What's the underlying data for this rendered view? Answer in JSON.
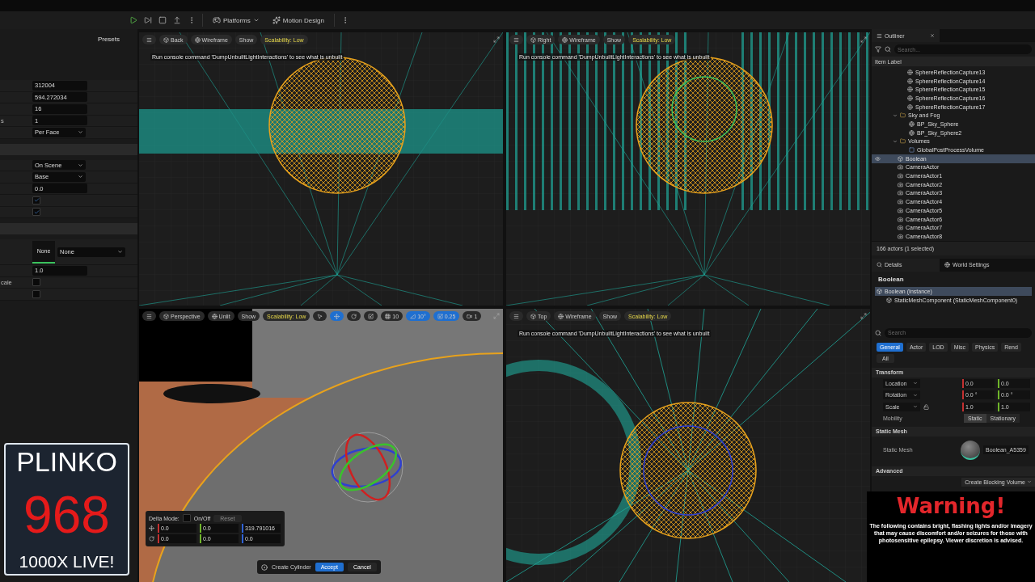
{
  "toolbar": {
    "items": [
      {
        "label": "Platforms"
      },
      {
        "label": "Motion Design"
      }
    ]
  },
  "left_panel": {
    "presets": "Presets",
    "rows": [
      {
        "kind": "field",
        "value": "312004"
      },
      {
        "kind": "field",
        "value": "594.272034"
      },
      {
        "kind": "field",
        "value": "16"
      },
      {
        "kind": "field",
        "label": "s",
        "value": "1"
      },
      {
        "kind": "dropdown",
        "value": "Per Face"
      },
      {
        "kind": "section"
      },
      {
        "kind": "dropdown",
        "value": "On Scene"
      },
      {
        "kind": "dropdown",
        "value": "Base"
      },
      {
        "kind": "field",
        "value": "0.0"
      },
      {
        "kind": "checkbox",
        "checked": true
      },
      {
        "kind": "checkbox",
        "checked": true
      },
      {
        "kind": "section"
      },
      {
        "kind": "asset",
        "thumb": "None",
        "value": "None"
      },
      {
        "kind": "field",
        "value": "1.0"
      },
      {
        "kind": "checkbox",
        "label": "cale",
        "checked": false
      },
      {
        "kind": "checkbox",
        "checked": false
      }
    ]
  },
  "viewports": [
    {
      "kind": "ortho",
      "view": "Back",
      "mode": "Wireframe",
      "show": "Show",
      "scalability": "Scalability: Low",
      "message": "Run console command 'DumpUnbuiltLightInteractions' to see what is unbuilt"
    },
    {
      "kind": "ortho",
      "view": "Right",
      "mode": "Wireframe",
      "show": "Show",
      "scalability": "Scalability: Low",
      "message": "Run console command 'DumpUnbuiltLightInteractions' to see what is unbuilt"
    },
    {
      "kind": "perspective",
      "view": "Perspective",
      "mode": "Unlit",
      "show": "Show",
      "scalability": "Scalability: Low",
      "tools": [
        {
          "selected": false
        },
        {
          "selected": true
        },
        {
          "selected": false
        },
        {
          "selected": false
        }
      ],
      "snaps": [
        {
          "value": "10",
          "on": false
        },
        {
          "value": "10°",
          "on": true
        },
        {
          "value": "0.25",
          "on": true
        }
      ],
      "camera_speed": "1",
      "delta": {
        "label": "Delta Mode:",
        "toggle": "On/Off",
        "checked": false,
        "reset": "Reset",
        "disabled": true,
        "rows": [
          [
            "0.0",
            "0.0",
            "319.791016"
          ],
          [
            "0.0",
            "0.0",
            "0.0"
          ]
        ]
      },
      "create": {
        "label": "Create Cylinder",
        "accept": "Accept",
        "cancel": "Cancel"
      }
    },
    {
      "kind": "ortho",
      "view": "Top",
      "mode": "Wireframe",
      "show": "Show",
      "scalability": "Scalability: Low",
      "message": "Run console command 'DumpUnbuiltLightInteractions' to see what is unbuilt"
    }
  ],
  "outliner": {
    "tab": "Outliner",
    "search": {
      "placeholder": "Search..."
    },
    "header": "Item Label",
    "items": [
      {
        "kind": "capture",
        "label": "SphereReflectionCapture13",
        "selected": false
      },
      {
        "kind": "capture",
        "label": "SphereReflectionCapture14",
        "selected": false
      },
      {
        "kind": "capture",
        "label": "SphereReflectionCapture15",
        "selected": false
      },
      {
        "kind": "capture",
        "label": "SphereReflectionCapture16",
        "selected": false
      },
      {
        "kind": "capture",
        "label": "SphereReflectionCapture17",
        "selected": false
      },
      {
        "kind": "folder",
        "label": "Sky and Fog",
        "expanded": true,
        "selected": false,
        "children": [
          {
            "kind": "sky",
            "label": "BP_Sky_Sphere",
            "selected": false
          },
          {
            "kind": "sky",
            "label": "BP_Sky_Sphere2",
            "selected": false
          }
        ]
      },
      {
        "kind": "folder",
        "label": "Volumes",
        "expanded": true,
        "selected": false,
        "children": [
          {
            "kind": "volume",
            "label": "GlobalPostProcessVolume",
            "selected": false
          }
        ]
      },
      {
        "kind": "mesh",
        "label": "Boolean",
        "selected": true
      },
      {
        "kind": "camera",
        "label": "CameraActor",
        "selected": false
      },
      {
        "kind": "camera",
        "label": "CameraActor1",
        "selected": false
      },
      {
        "kind": "camera",
        "label": "CameraActor2",
        "selected": false
      },
      {
        "kind": "camera",
        "label": "CameraActor3",
        "selected": false
      },
      {
        "kind": "camera",
        "label": "CameraActor4",
        "selected": false
      },
      {
        "kind": "camera",
        "label": "CameraActor5",
        "selected": false
      },
      {
        "kind": "camera",
        "label": "CameraActor6",
        "selected": false
      },
      {
        "kind": "camera",
        "label": "CameraActor7",
        "selected": false
      },
      {
        "kind": "camera",
        "label": "CameraActor8",
        "selected": false
      }
    ],
    "status": "166 actors (1 selected)"
  },
  "details": {
    "tabs": [
      {
        "label": "Details",
        "selected": true
      },
      {
        "label": "World Settings",
        "selected": false
      }
    ],
    "title": "Boolean",
    "components": [
      {
        "label": "Boolean (Instance)",
        "selected": true,
        "children": [
          {
            "label": "StaticMeshComponent (StaticMeshComponent0)",
            "selected": false
          }
        ]
      }
    ],
    "search": {
      "placeholder": "Search"
    },
    "filters": [
      {
        "label": "General",
        "selected": true
      },
      {
        "label": "Actor",
        "selected": false
      },
      {
        "label": "LOD",
        "selected": false
      },
      {
        "label": "Misc",
        "selected": false
      },
      {
        "label": "Physics",
        "selected": false
      },
      {
        "label": "Rend",
        "selected": false
      },
      {
        "label": "All",
        "selected": false
      }
    ],
    "transform": {
      "title": "Transform",
      "rows": [
        {
          "label": "Location",
          "values": [
            "0.0",
            "0.0"
          ]
        },
        {
          "label": "Rotation",
          "values": [
            "0.0 °",
            "0.0 °"
          ]
        },
        {
          "label": "Scale",
          "values": [
            "1.0",
            "1.0"
          ],
          "locked": false
        }
      ],
      "mobility": {
        "label": "Mobility",
        "options": [
          {
            "label": "Static",
            "selected": true
          },
          {
            "label": "Stationary",
            "selected": false
          }
        ]
      }
    },
    "static_mesh": {
      "title": "Static Mesh",
      "label": "Static Mesh",
      "asset": "Boolean_A5359"
    },
    "advanced": {
      "title": "Advanced",
      "button": "Create Blocking Volume"
    }
  },
  "plinko": {
    "title": "PLINKO",
    "number": "968",
    "tagline": "1000X LIVE!"
  },
  "warning": {
    "title": "Warning!",
    "text": "The following contains bright, flashing lights and/or imagery that may cause discomfort and/or seizures for those with photosensitive epilepsy. Viewer discretion is advised."
  }
}
